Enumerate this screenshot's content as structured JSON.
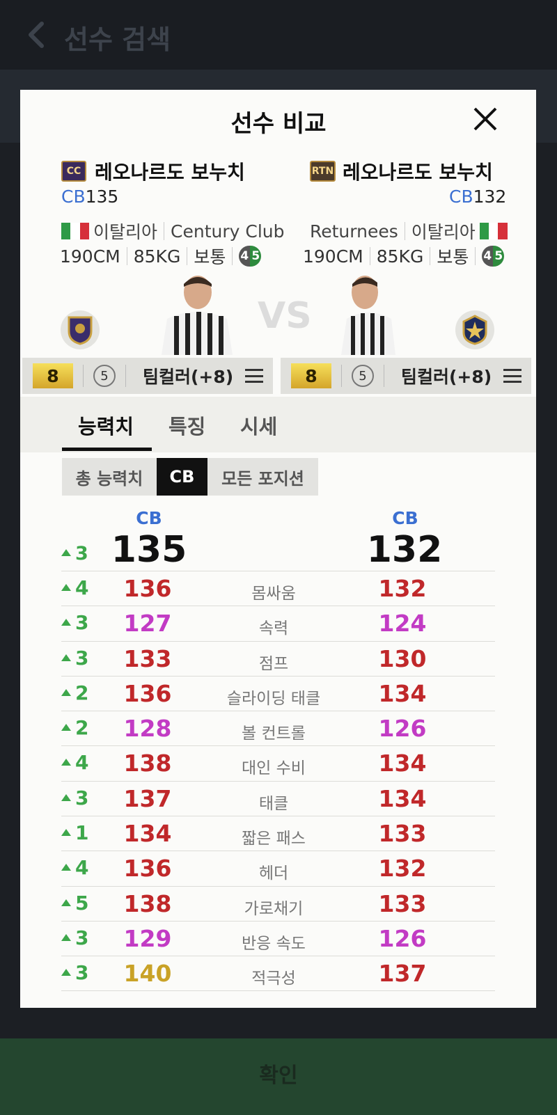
{
  "topbar": {
    "title": "선수 검색"
  },
  "modal": {
    "title": "선수 비교",
    "confirm_label": "확인"
  },
  "left": {
    "badge": "CC",
    "name": "레오나르도 보누치",
    "pos": "CB",
    "ovr": "135",
    "nation": "이탈리아",
    "season": "Century Club",
    "height": "190CM",
    "weight": "85KG",
    "build": "보통",
    "foot_l": "4",
    "foot_r": "5",
    "level": "8",
    "grade": "5",
    "teamcolor": "팀컬러(+8)"
  },
  "right": {
    "badge": "RTN",
    "name": "레오나르도 보누치",
    "pos": "CB",
    "ovr": "132",
    "nation": "이탈리아",
    "season": "Returnees",
    "height": "190CM",
    "weight": "85KG",
    "build": "보통",
    "foot_l": "4",
    "foot_r": "5",
    "level": "8",
    "grade": "5",
    "teamcolor": "팀컬러(+8)"
  },
  "vs": "VS",
  "tabs": [
    "능력치",
    "특징",
    "시세"
  ],
  "segments": [
    "총 능력치",
    "CB",
    "모든 포지션"
  ],
  "header": {
    "left_pos": "CB",
    "right_pos": "CB",
    "left_val": "135",
    "right_val": "132",
    "delta": "3"
  },
  "colors": {
    "red": "#c0282a",
    "purple": "#c23bc4",
    "gold": "#c9a227",
    "green": "#3da74a",
    "blue": "#3b6fd1"
  },
  "stats": [
    {
      "name": "몸싸움",
      "delta": "4",
      "left": "136",
      "right": "132",
      "lc": "red",
      "rc": "red"
    },
    {
      "name": "속력",
      "delta": "3",
      "left": "127",
      "right": "124",
      "lc": "purple",
      "rc": "purple"
    },
    {
      "name": "점프",
      "delta": "3",
      "left": "133",
      "right": "130",
      "lc": "red",
      "rc": "red"
    },
    {
      "name": "슬라이딩 태클",
      "delta": "2",
      "left": "136",
      "right": "134",
      "lc": "red",
      "rc": "red"
    },
    {
      "name": "볼 컨트롤",
      "delta": "2",
      "left": "128",
      "right": "126",
      "lc": "purple",
      "rc": "purple"
    },
    {
      "name": "대인 수비",
      "delta": "4",
      "left": "138",
      "right": "134",
      "lc": "red",
      "rc": "red"
    },
    {
      "name": "태클",
      "delta": "3",
      "left": "137",
      "right": "134",
      "lc": "red",
      "rc": "red"
    },
    {
      "name": "짧은 패스",
      "delta": "1",
      "left": "134",
      "right": "133",
      "lc": "red",
      "rc": "red"
    },
    {
      "name": "헤더",
      "delta": "4",
      "left": "136",
      "right": "132",
      "lc": "red",
      "rc": "red"
    },
    {
      "name": "가로채기",
      "delta": "5",
      "left": "138",
      "right": "133",
      "lc": "red",
      "rc": "red"
    },
    {
      "name": "반응 속도",
      "delta": "3",
      "left": "129",
      "right": "126",
      "lc": "purple",
      "rc": "purple"
    },
    {
      "name": "적극성",
      "delta": "3",
      "left": "140",
      "right": "137",
      "lc": "gold",
      "rc": "red"
    }
  ]
}
